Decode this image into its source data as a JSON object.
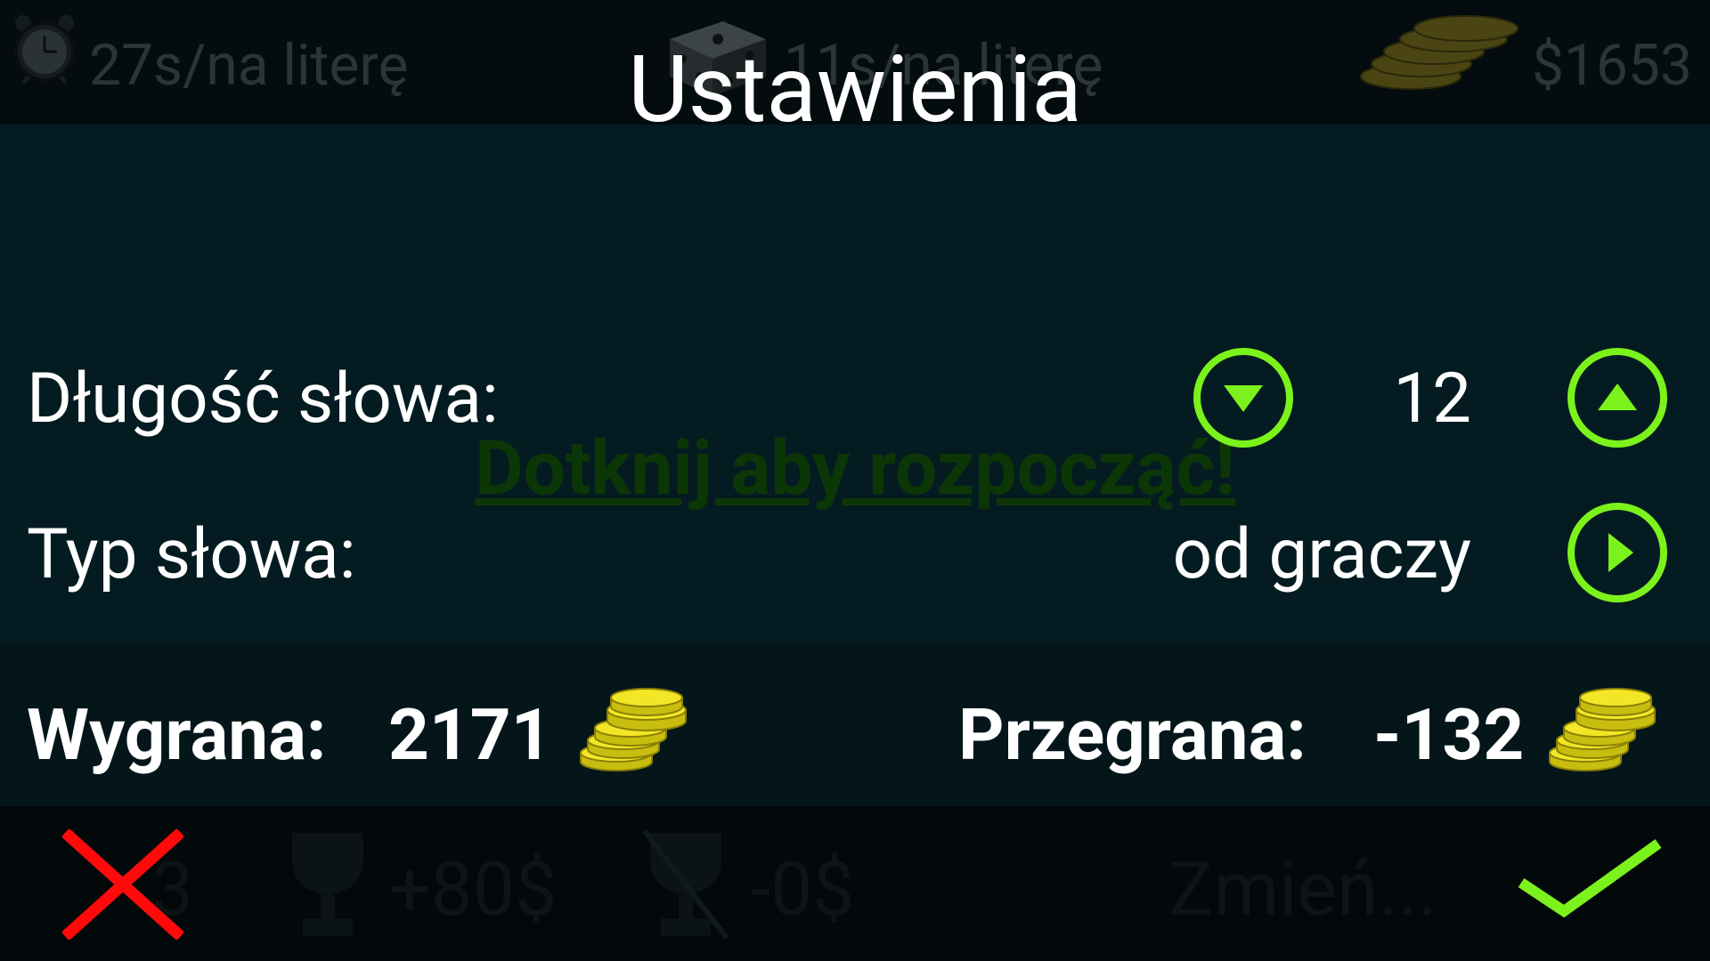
{
  "background": {
    "top_bar": {
      "timer_text": "27s/na literę",
      "dice_text": "11s/na literę",
      "money_text": "$1653"
    },
    "tap_to_start": "Dotknij aby rozpocząć!",
    "bottom_bar": {
      "count_text": "3",
      "bonus_text": "+80$",
      "penalty_text": "-0$",
      "change_text": "Zmień..."
    }
  },
  "dialog": {
    "title": "Ustawienia",
    "word_length": {
      "label": "Długość słowa:",
      "value": "12"
    },
    "word_type": {
      "label": "Typ słowa:",
      "value": "od graczy"
    },
    "stats": {
      "win_label": "Wygrana:",
      "win_value": "2171",
      "loss_label": "Przegrana:",
      "loss_value": "-132"
    }
  },
  "icons": {
    "alarm_clock": "alarm-clock-icon",
    "dice": "dice-icon",
    "coins": "coin-stack-icon",
    "arrow_down": "triangle-down-icon",
    "arrow_up": "triangle-up-icon",
    "arrow_right": "triangle-right-icon",
    "cancel": "red-x-icon",
    "confirm": "green-check-icon"
  },
  "colors": {
    "accent_green": "#7cf21c",
    "cancel_red": "#ff0a0a",
    "panel_bg": "#041c21",
    "coin_gold": "#e8dc1a"
  }
}
